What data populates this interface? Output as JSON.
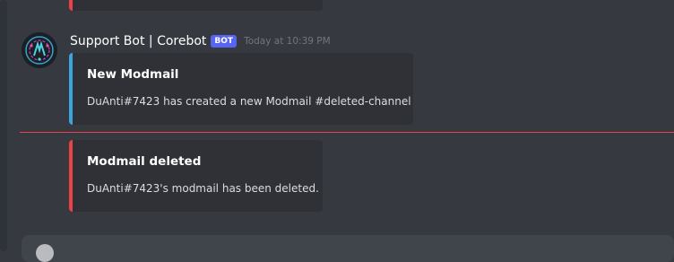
{
  "message": {
    "username": "Support Bot | Corebot",
    "bot_tag": "BOT",
    "timestamp": "Today at 10:39 PM"
  },
  "embeds": [
    {
      "title": "New Modmail",
      "description": "DuAnti#7423 has created a new Modmail #deleted-channel",
      "accent_color": "#3ba5dd"
    },
    {
      "title": "Modmail deleted",
      "description": "DuAnti#7423's modmail has been deleted.",
      "accent_color": "#ed4245"
    }
  ],
  "composer": {
    "placeholder": ""
  },
  "colors": {
    "background": "#36393f",
    "embed_background": "#2f3136",
    "bot_tag": "#5865f2",
    "new_messages_divider": "#ed4245"
  }
}
